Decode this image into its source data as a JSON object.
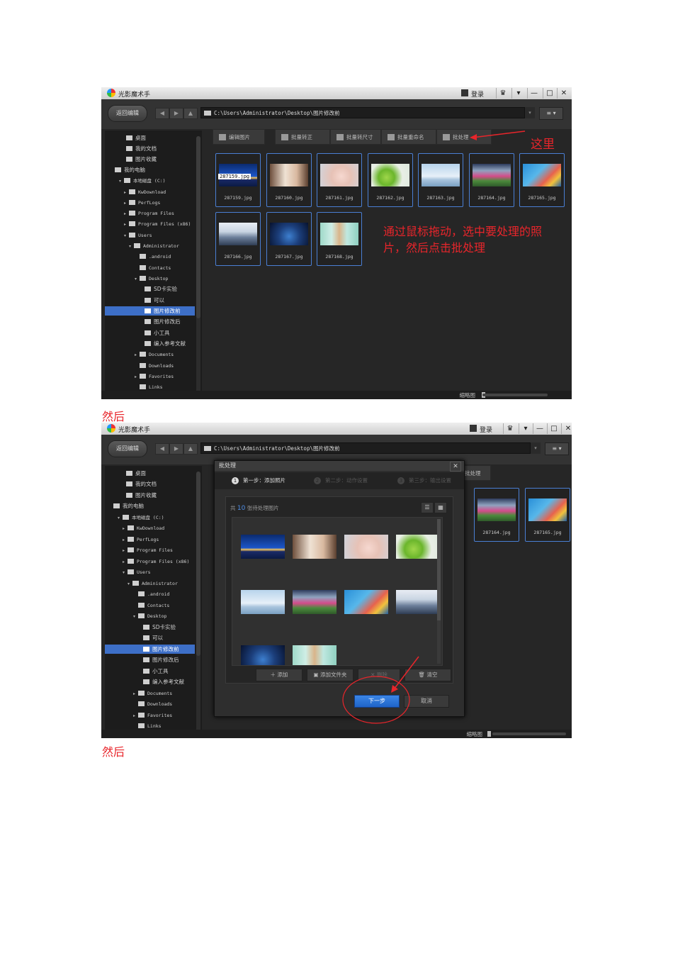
{
  "app": {
    "title": "光影魔术手",
    "login": "登录",
    "win_buttons": [
      "♛",
      "▾",
      "—",
      "□",
      "✕"
    ],
    "back_label": "返回编辑",
    "path": "C:\\Users\\Administrator\\Desktop\\图片修改前",
    "zoom_label": "缩略图"
  },
  "sidebar": {
    "items": [
      {
        "label": "桌面"
      },
      {
        "label": "我的文档"
      },
      {
        "label": "图片收藏"
      },
      {
        "label": "我的电脑"
      },
      {
        "label": "本地磁盘 (C:)"
      },
      {
        "label": "KwDownload"
      },
      {
        "label": "PerfLogs"
      },
      {
        "label": "Program Files"
      },
      {
        "label": "Program Files (x86)"
      },
      {
        "label": "Users"
      },
      {
        "label": "Administrator"
      },
      {
        "label": ".android"
      },
      {
        "label": "Contacts"
      },
      {
        "label": "Desktop"
      },
      {
        "label": "SD卡实验"
      },
      {
        "label": "可以"
      },
      {
        "label": "图片修改前",
        "selected": true
      },
      {
        "label": "图片修改后"
      },
      {
        "label": "小工具"
      },
      {
        "label": "编入参考文献"
      },
      {
        "label": "Documents"
      },
      {
        "label": "Downloads"
      },
      {
        "label": "Favorites"
      },
      {
        "label": "Links"
      }
    ]
  },
  "toolbar": {
    "edit": "编辑图片",
    "rotate": "批量转正",
    "resize": "批量转尺寸",
    "rename": "批量重命名",
    "batch": "批处理"
  },
  "files": [
    {
      "name": "287159.jpg",
      "tag": "287159.jpg"
    },
    {
      "name": "287160.jpg"
    },
    {
      "name": "287161.jpg"
    },
    {
      "name": "287162.jpg"
    },
    {
      "name": "287163.jpg"
    },
    {
      "name": "287164.jpg"
    },
    {
      "name": "287165.jpg"
    },
    {
      "name": "287166.jpg"
    },
    {
      "name": "287167.jpg"
    },
    {
      "name": "287168.jpg"
    }
  ],
  "annotations": {
    "here": "这里",
    "instruction_line1": "通过鼠标拖动，选中要处理的照",
    "instruction_line2": "片，然后点击批处理",
    "then1": "然后",
    "then2": "然后"
  },
  "dialog": {
    "title": "批处理",
    "close": "✕",
    "steps": [
      {
        "num": "1",
        "label": "第一步：添加照片"
      },
      {
        "num": "2",
        "label": "第二步：动作设置"
      },
      {
        "num": "3",
        "label": "第三步：输出设置"
      }
    ],
    "count_prefix": "共",
    "count": "10",
    "count_suffix": "张待处理图片",
    "add": "添加",
    "add_folder": "添加文件夹",
    "delete": "删除",
    "clear": "清空",
    "next": "下一步",
    "cancel": "取消",
    "behind_button": "批处理"
  },
  "colors": {
    "accent": "#3d6fc7",
    "annotation": "#e8252b"
  }
}
